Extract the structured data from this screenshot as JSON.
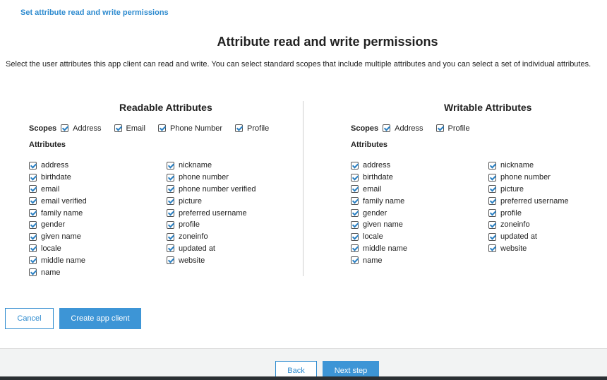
{
  "header": {
    "link_text": "Set attribute read and write permissions",
    "title": "Attribute read and write permissions",
    "description": "Select the user attributes this app client can read and write. You can select standard scopes that include multiple attributes and you can select a set of individual attributes."
  },
  "readable": {
    "heading": "Readable Attributes",
    "scopes_label": "Scopes",
    "scopes": [
      "Address",
      "Email",
      "Phone Number",
      "Profile"
    ],
    "attributes_label": "Attributes",
    "col1": [
      "address",
      "birthdate",
      "email",
      "email verified",
      "family name",
      "gender",
      "given name",
      "locale",
      "middle name",
      "name"
    ],
    "col2": [
      "nickname",
      "phone number",
      "phone number verified",
      "picture",
      "preferred username",
      "profile",
      "zoneinfo",
      "updated at",
      "website"
    ]
  },
  "writable": {
    "heading": "Writable Attributes",
    "scopes_label": "Scopes",
    "scopes": [
      "Address",
      "Profile"
    ],
    "attributes_label": "Attributes",
    "col1": [
      "address",
      "birthdate",
      "email",
      "family name",
      "gender",
      "given name",
      "locale",
      "middle name",
      "name"
    ],
    "col2": [
      "nickname",
      "phone number",
      "picture",
      "preferred username",
      "profile",
      "zoneinfo",
      "updated at",
      "website"
    ]
  },
  "actions": {
    "cancel_label": "Cancel",
    "create_label": "Create app client"
  },
  "footer": {
    "back_label": "Back",
    "next_label": "Next step"
  },
  "colors": {
    "accent": "#2e8bcf",
    "primary_button": "#3d95d6",
    "check": "#2a7fc1",
    "footer_bg": "#f2f3f3"
  }
}
